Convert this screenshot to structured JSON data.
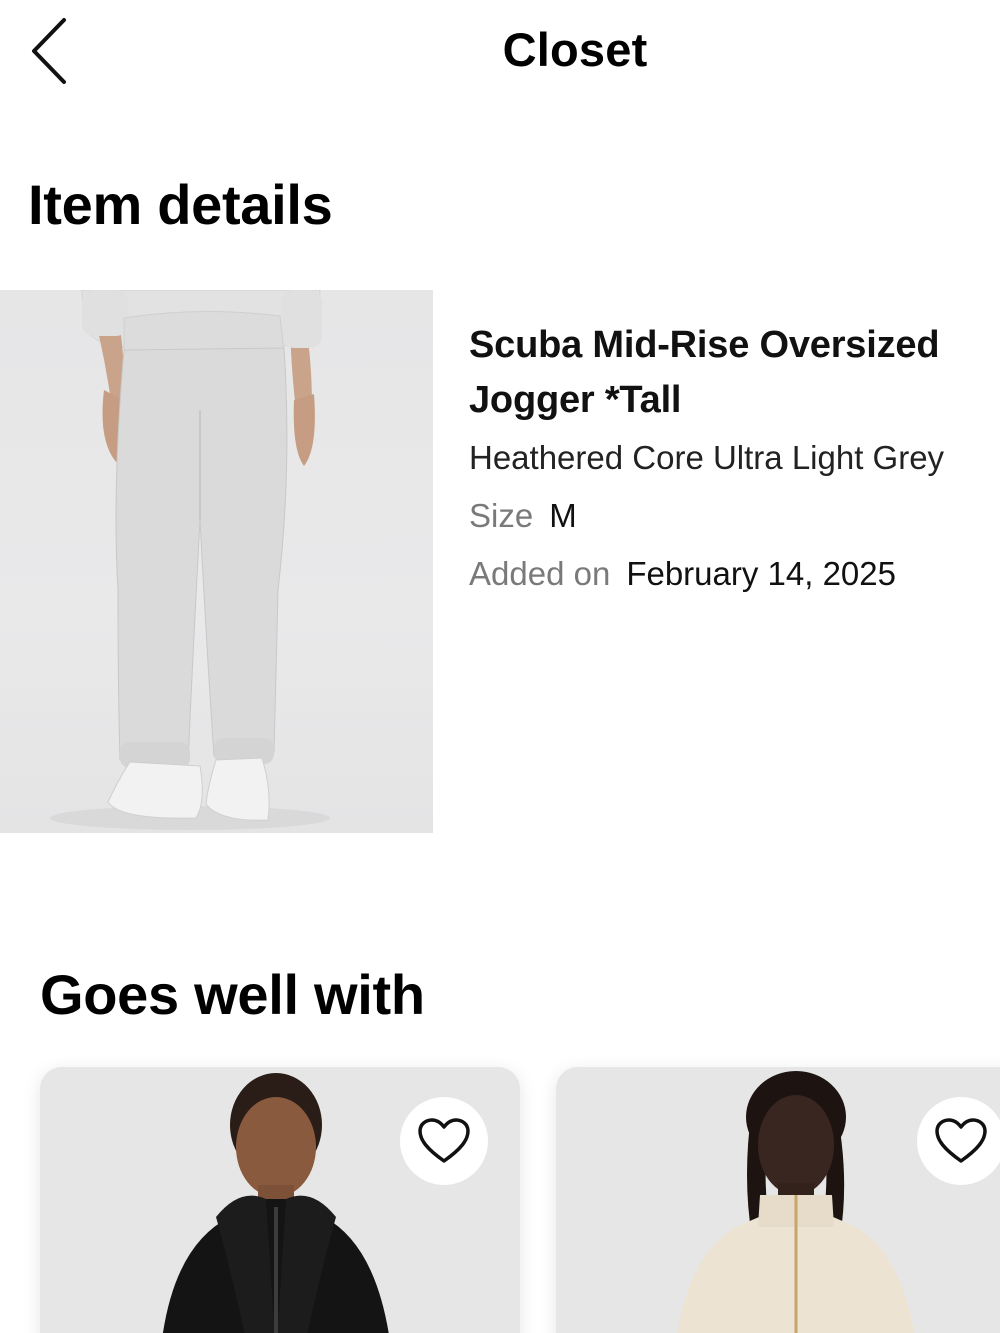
{
  "header": {
    "title": "Closet",
    "back_icon": "chevron-left-icon"
  },
  "item_details": {
    "heading": "Item details",
    "product": {
      "name": "Scuba Mid-Rise Oversized Jogger *Tall",
      "color": "Heathered Core Ultra Light Grey",
      "size_label": "Size",
      "size_value": "M",
      "added_label": "Added on",
      "added_value": "February 14, 2025",
      "image": "light-grey-jogger-pants-photo"
    }
  },
  "goes_well_with": {
    "heading": "Goes well with",
    "cards": [
      {
        "image": "black-hooded-zip-jacket-photo",
        "favorite_icon": "heart-outline-icon"
      },
      {
        "image": "cream-funnel-neck-zip-jacket-photo",
        "favorite_icon": "heart-outline-icon"
      }
    ]
  },
  "colors": {
    "background": "#ffffff",
    "text_primary": "#000000",
    "text_secondary": "#7a7a7a",
    "image_background": "#e6e6e7"
  }
}
